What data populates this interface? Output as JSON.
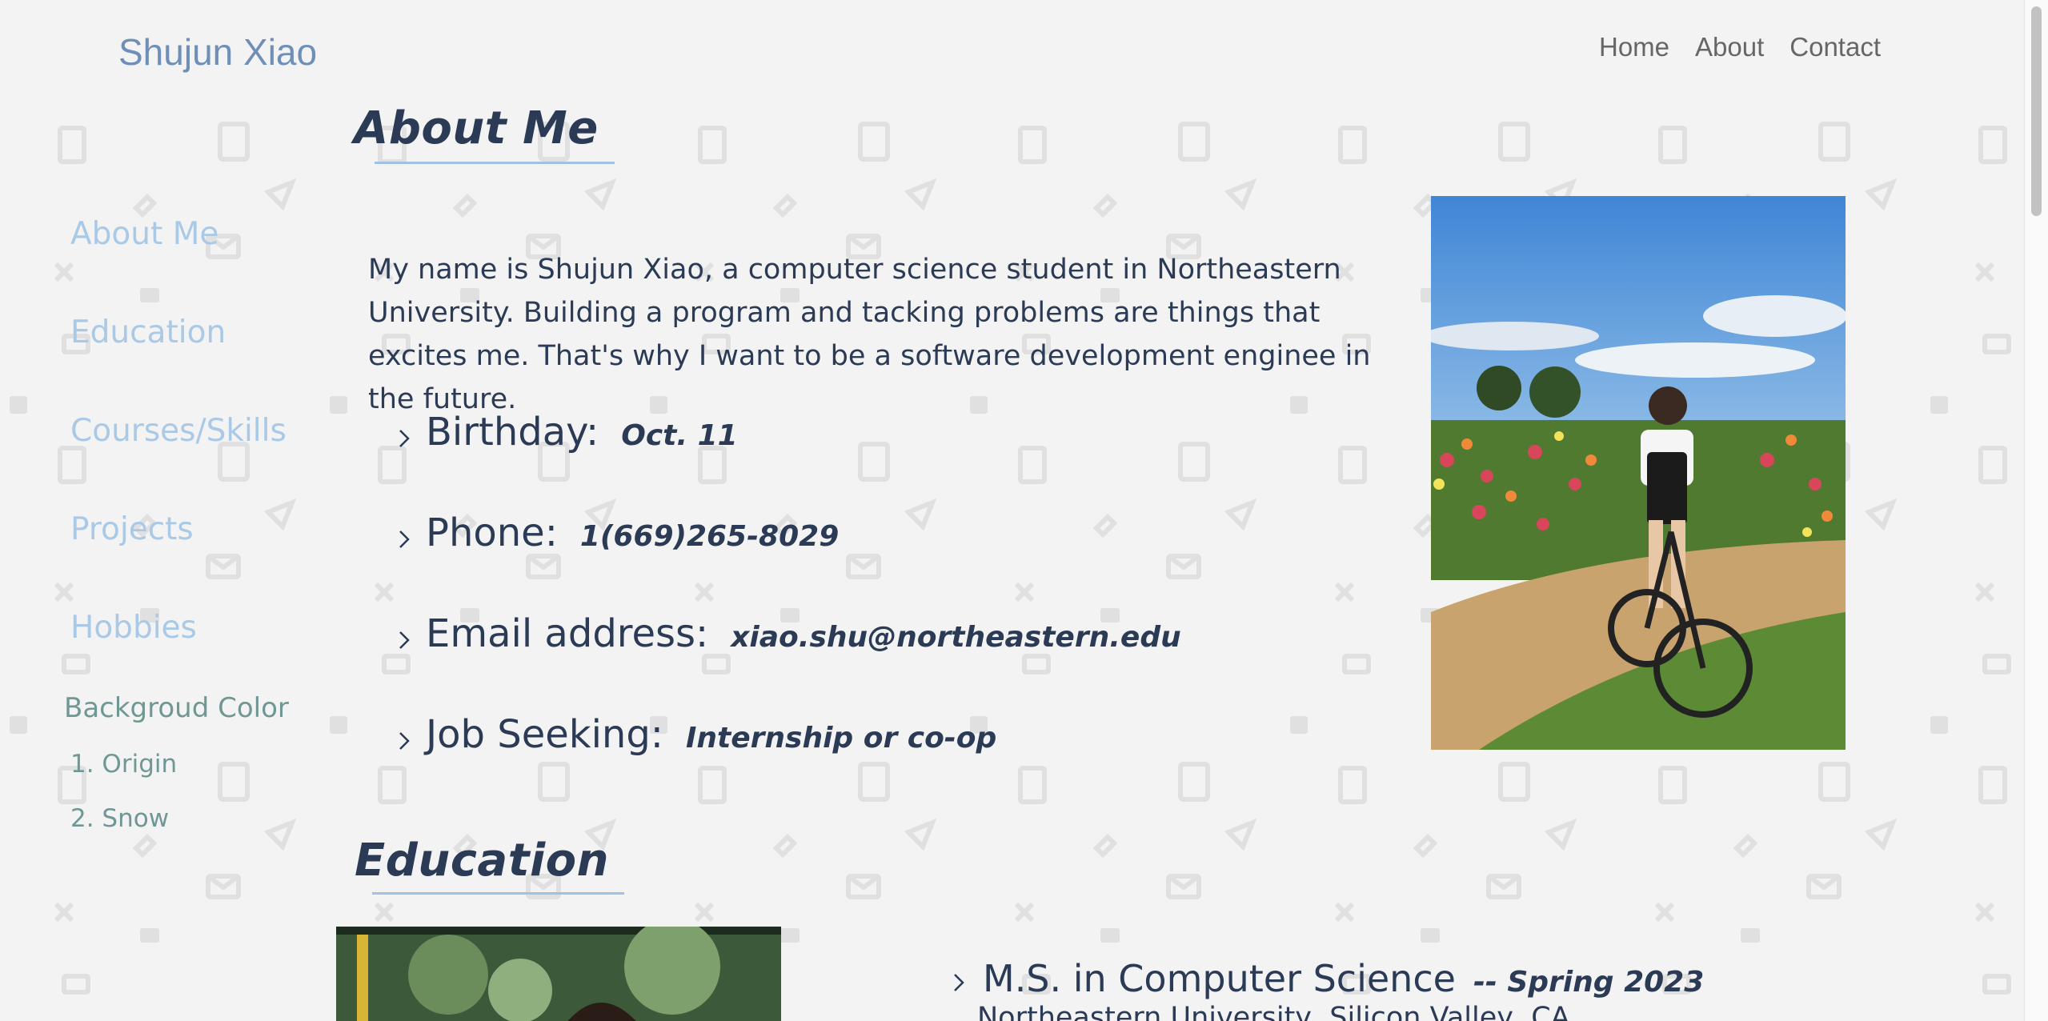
{
  "brand": "Shujun Xiao",
  "nav": [
    "Home",
    "About",
    "Contact"
  ],
  "sidebar": {
    "links": [
      "About Me",
      "Education",
      "Courses/Skills",
      "Projects",
      "Hobbies"
    ],
    "background_title": "Backgroud Color",
    "background_options": [
      "1. Origin",
      "2. Snow"
    ]
  },
  "about": {
    "title": "About Me",
    "intro": "My name is Shujun Xiao, a computer science student in Northeastern University. Building a program and tacking problems are things that excites me. That's why I want to be a software development enginee in the future.",
    "items": [
      {
        "label": "Birthday:",
        "value": "Oct. 11"
      },
      {
        "label": "Phone:",
        "value": "1(669)265-8029"
      },
      {
        "label": "Email address:",
        "value": "xiao.shu@northeastern.edu"
      },
      {
        "label": "Job Seeking:",
        "value": "Internship or co-op"
      }
    ]
  },
  "education": {
    "title": "Education",
    "degree": "M.S. in Computer Science",
    "date": "-- Spring 2023",
    "school": "Northeastern University, Silicon Valley, CA"
  },
  "colors": {
    "accent": "#a9c9e6",
    "heading": "#2b3a55",
    "brand": "#6f8fb8",
    "background": "#f3f3f3"
  },
  "icons": [
    "chevron-right-icon",
    "phone-icon",
    "mail-icon",
    "pencil-icon",
    "tablet-icon",
    "coffee-icon",
    "send-icon"
  ]
}
